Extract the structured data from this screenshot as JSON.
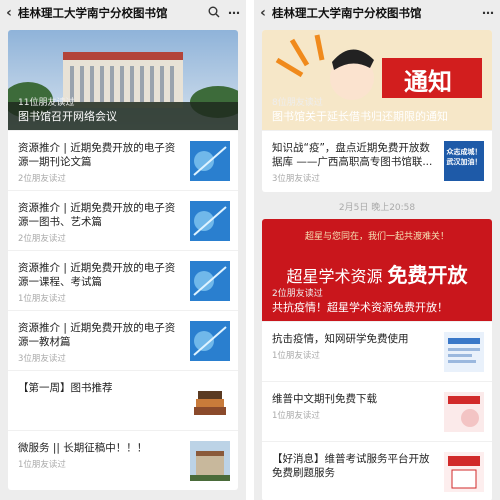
{
  "left": {
    "title": "桂林理工大学南宁分校图书馆",
    "hero": {
      "reads": "11位朋友读过",
      "title": "图书馆召开网络会议"
    },
    "items": [
      {
        "title": "资源推介 | 近期免费开放的电子资源一期刊论文篇",
        "reads": "2位朋友读过"
      },
      {
        "title": "资源推介 | 近期免费开放的电子资源一图书、艺术篇",
        "reads": "2位朋友读过"
      },
      {
        "title": "资源推介 | 近期免费开放的电子资源一课程、考试篇",
        "reads": "1位朋友读过"
      },
      {
        "title": "资源推介 | 近期免费开放的电子资源一教材篇",
        "reads": "3位朋友读过"
      },
      {
        "title": "【第一周】图书推荐",
        "reads": ""
      },
      {
        "title": "微服务 || 长期征稿中！！！",
        "reads": "1位朋友读过"
      }
    ]
  },
  "right": {
    "title": "桂林理工大学南宁分校图书馆",
    "hero1": {
      "reads": "8位朋友读过",
      "title": "图书馆关于延长借书归还期限的通知",
      "banner": "通知"
    },
    "item1": {
      "title": "知识战“疫”，盘点近期免费开放数据库 ——广西高职高专图书馆联...",
      "reads": "3位朋友读过",
      "thumb_text": "众志成城！武汉加油！"
    },
    "date": "2月5日 晚上20:58",
    "hero2": {
      "reads": "2位朋友读过",
      "title": "共抗疫情！超星学术资源免费开放！",
      "line1": "超星与您同在，我们一起共渡难关！",
      "line2a": "超星学术资源",
      "line2b": "免费开放"
    },
    "items": [
      {
        "title": "抗击疫情，知网研学免费使用",
        "reads": "1位朋友读过"
      },
      {
        "title": "维普中文期刊免费下载",
        "reads": "1位朋友读过"
      },
      {
        "title": "【好消息】维普考试服务平台开放免费刷题服务",
        "reads": ""
      }
    ]
  },
  "colors": {
    "panel_bg": "#ededed",
    "red_banner": "#c9161c",
    "orange": "#f08a1c"
  }
}
